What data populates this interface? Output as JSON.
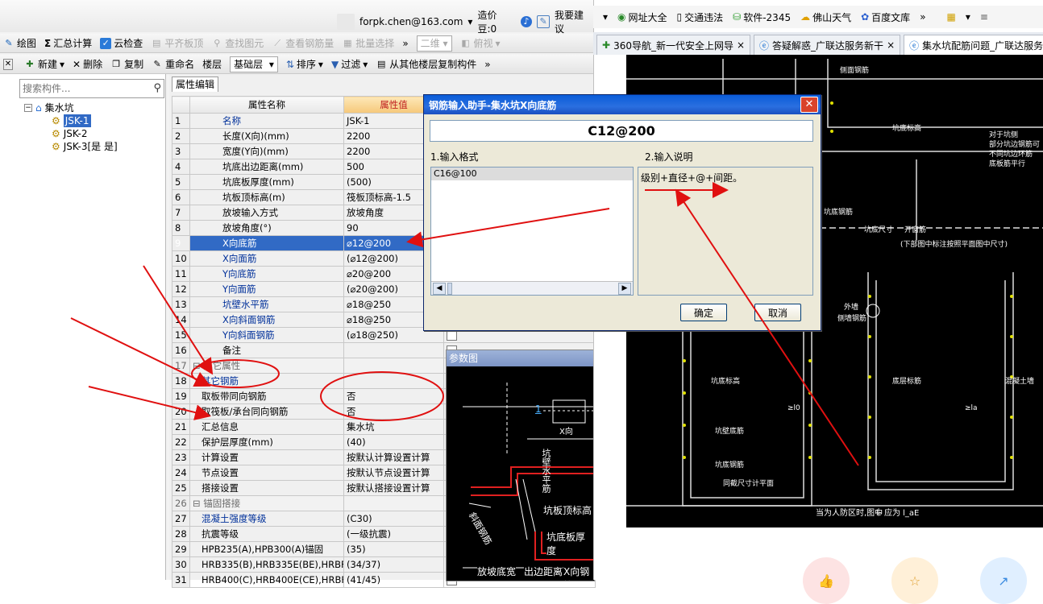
{
  "app": {
    "user_account": "forpk.chen@163.com",
    "points_label": "造价豆:0",
    "suggest_label": "我要建议",
    "toolbar1": {
      "items": [
        "绘图",
        "汇总计算",
        "云检查",
        "平齐板顶",
        "查找图元",
        "查看钢筋量",
        "批量选择"
      ],
      "view_combo": "二维",
      "view_mode": "俯视"
    },
    "toolbar2": {
      "new_label": "新建",
      "delete_label": "删除",
      "copy_label": "复制",
      "rename_label": "重命名",
      "floor_label": "楼层",
      "floor_value": "基础层",
      "sort_label": "排序",
      "filter_label": "过滤",
      "copy_from_label": "从其他楼层复制构件"
    },
    "search_placeholder": "搜索构件...",
    "tree": {
      "root": "集水坑",
      "children": [
        "JSK-1",
        "JSK-2",
        "JSK-3[是 是]"
      ]
    },
    "prop_tab": "属性编辑",
    "grid": {
      "headers": [
        "属性名称",
        "属性值"
      ],
      "rows": [
        {
          "n": "1",
          "name": "名称",
          "value": "JSK-1"
        },
        {
          "n": "2",
          "name": "长度(X向)(mm)",
          "value": "2200"
        },
        {
          "n": "3",
          "name": "宽度(Y向)(mm)",
          "value": "2200"
        },
        {
          "n": "4",
          "name": "坑底出边距离(mm)",
          "value": "500"
        },
        {
          "n": "5",
          "name": "坑底板厚度(mm)",
          "value": "(500)"
        },
        {
          "n": "6",
          "name": "坑板顶标高(m)",
          "value": "筏板顶标高-1.5"
        },
        {
          "n": "7",
          "name": "放坡输入方式",
          "value": "放坡角度"
        },
        {
          "n": "8",
          "name": "放坡角度(°)",
          "value": "90"
        },
        {
          "n": "9",
          "name": "X向底筋",
          "value": "⌀12@200"
        },
        {
          "n": "10",
          "name": "X向面筋",
          "value": "(⌀12@200)"
        },
        {
          "n": "11",
          "name": "Y向底筋",
          "value": "⌀20@200"
        },
        {
          "n": "12",
          "name": "Y向面筋",
          "value": "(⌀20@200)"
        },
        {
          "n": "13",
          "name": "坑壁水平筋",
          "value": "⌀18@250"
        },
        {
          "n": "14",
          "name": "X向斜面钢筋",
          "value": "⌀18@250"
        },
        {
          "n": "15",
          "name": "Y向斜面钢筋",
          "value": "(⌀18@250)"
        },
        {
          "n": "16",
          "name": "备注",
          "value": ""
        },
        {
          "n": "17",
          "name": "其它属性",
          "value": ""
        },
        {
          "n": "18",
          "name": "其它钢筋",
          "value": ""
        },
        {
          "n": "19",
          "name": "取板带同向钢筋",
          "value": "否"
        },
        {
          "n": "20",
          "name": "取筏板/承台同向钢筋",
          "value": "否"
        },
        {
          "n": "21",
          "name": "汇总信息",
          "value": "集水坑"
        },
        {
          "n": "22",
          "name": "保护层厚度(mm)",
          "value": "(40)"
        },
        {
          "n": "23",
          "name": "计算设置",
          "value": "按默认计算设置计算"
        },
        {
          "n": "24",
          "name": "节点设置",
          "value": "按默认节点设置计算"
        },
        {
          "n": "25",
          "name": "搭接设置",
          "value": "按默认搭接设置计算"
        },
        {
          "n": "26",
          "name": "锚固搭接",
          "value": ""
        },
        {
          "n": "27",
          "name": "混凝土强度等级",
          "value": "(C30)"
        },
        {
          "n": "28",
          "name": "抗震等级",
          "value": "(一级抗震)"
        },
        {
          "n": "29",
          "name": "HPB235(A),HPB300(A)锚固",
          "value": "(35)"
        },
        {
          "n": "30",
          "name": "HRB335(B),HRB335E(BE),HRBF",
          "value": "(34/37)"
        },
        {
          "n": "31",
          "name": "HRB400(C),HRB400E(CE),HRBF",
          "value": "(41/45)"
        }
      ]
    },
    "param_panel": {
      "title": "参数图",
      "labels": [
        "1",
        "X向",
        "坑壁水平筋",
        "坑板顶标高",
        "坑底板厚度",
        "斜面钢筋",
        "放坡底宽",
        "出边距离",
        "X向钢筋"
      ]
    }
  },
  "dialog": {
    "title": "钢筋输入助手-集水坑X向底筋",
    "input_value": "C12@200",
    "format_label": "1.输入格式",
    "format_item": "C16@100",
    "desc_label": "2.输入说明",
    "desc_text": "级别+直径+@+间距。",
    "ok_label": "确定",
    "cancel_label": "取消"
  },
  "browser": {
    "favorites": [
      "网址大全",
      "交通违法",
      "软件-2345",
      "佛山天气",
      "百度文库"
    ],
    "tabs": [
      "360导航_新一代安全上网导",
      "答疑解惑_广联达服务新干",
      "集水坑配筋问题_广联达服务"
    ],
    "cad_labels": [
      "侧面钢筋",
      "坑底标高",
      "对于坑侧",
      "部分坑边钢筋可",
      "不同坑边环筋",
      "底板筋平行",
      "坑底钢筋",
      "坑底尺寸",
      "开窗筋",
      "(下部图中标注按照平面图中尺寸)",
      "外墙",
      "侧墙钢筋",
      "坑底标高",
      "坑壁底筋",
      "坑底钢筋",
      "底层标筋",
      "混凝土墙",
      "≥l0",
      "≥la",
      "同截尺寸计平面",
      "当为人防区时,图中",
      "l₀ 应为 l_aE"
    ]
  }
}
